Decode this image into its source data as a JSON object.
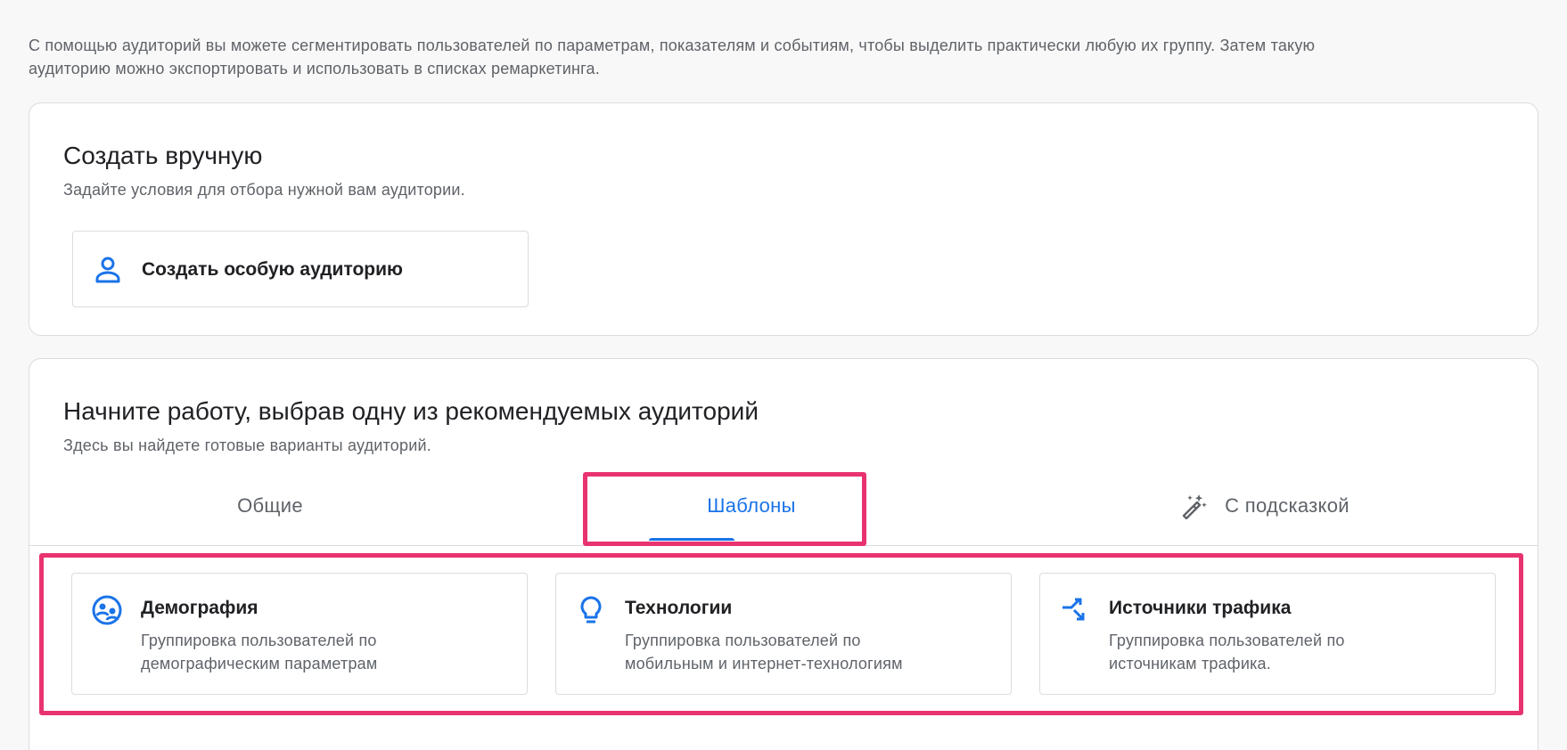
{
  "intro": {
    "line1": "С помощью аудиторий вы можете сегментировать пользователей по параметрам, показателям и событиям, чтобы выделить практически любую их группу. Затем такую",
    "line2": "аудиторию можно экспортировать и использовать в списках ремаркетинга."
  },
  "manual": {
    "title": "Создать вручную",
    "subtitle": "Задайте условия для отбора нужной вам аудитории.",
    "button_label": "Создать особую аудиторию",
    "button_icon": "person-icon"
  },
  "recommended": {
    "title": "Начните работу, выбрав одну из рекомендуемых аудиторий",
    "subtitle": "Здесь вы найдете готовые варианты аудиторий.",
    "tabs": [
      {
        "label": "Общие",
        "active": false
      },
      {
        "label": "Шаблоны",
        "active": true
      },
      {
        "label": "С подсказкой",
        "active": false,
        "icon": "magic-wand-icon"
      }
    ],
    "templates": [
      {
        "title": "Демография",
        "line1": "Группировка пользователей по",
        "line2": "демографическим параметрам",
        "icon": "demographics-icon"
      },
      {
        "title": "Технологии",
        "line1": "Группировка пользователей по",
        "line2": "мобильным и интернет-технологиям",
        "icon": "lightbulb-icon"
      },
      {
        "title": "Источники трафика",
        "line1": "Группировка пользователей по",
        "line2": "источникам трафика.",
        "icon": "traffic-split-icon"
      }
    ]
  },
  "colors": {
    "accent": "#1a73e8",
    "highlight": "#e8336f",
    "text_primary": "#202124",
    "text_secondary": "#5f6368",
    "border": "#dadce0",
    "background": "#f8f8f8"
  }
}
